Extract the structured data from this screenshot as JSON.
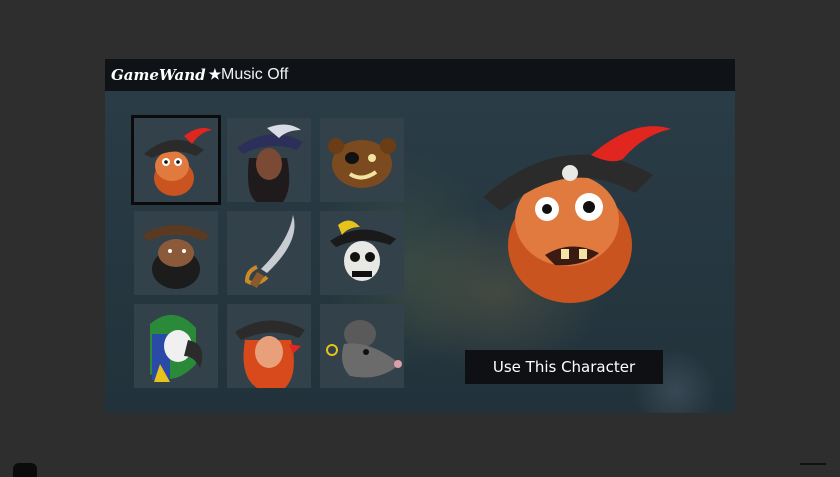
{
  "topbar": {
    "logo_text": "GameWand",
    "logo_icon": "star-icon",
    "music_toggle_label": "Music Off"
  },
  "characters": [
    {
      "name": "pirate-captain",
      "selected": true
    },
    {
      "name": "female-pirate",
      "selected": false
    },
    {
      "name": "eyepatch-bear",
      "selected": false
    },
    {
      "name": "bearded-pirate",
      "selected": false
    },
    {
      "name": "cutlass",
      "selected": false
    },
    {
      "name": "skeleton-pirate",
      "selected": false
    },
    {
      "name": "parrot",
      "selected": false
    },
    {
      "name": "redhead-pirate",
      "selected": false
    },
    {
      "name": "rat",
      "selected": false
    }
  ],
  "preview": {
    "character": "pirate-captain"
  },
  "actions": {
    "use_character_label": "Use This Character"
  },
  "colors": {
    "page_bg": "#2e2e2e",
    "panel_bg": "#243640",
    "topbar_bg": "#0f1216",
    "tile_bg": "#33414a",
    "button_bg": "#0e1013",
    "beard_orange": "#c9541f",
    "feather_red": "#e0261f"
  }
}
